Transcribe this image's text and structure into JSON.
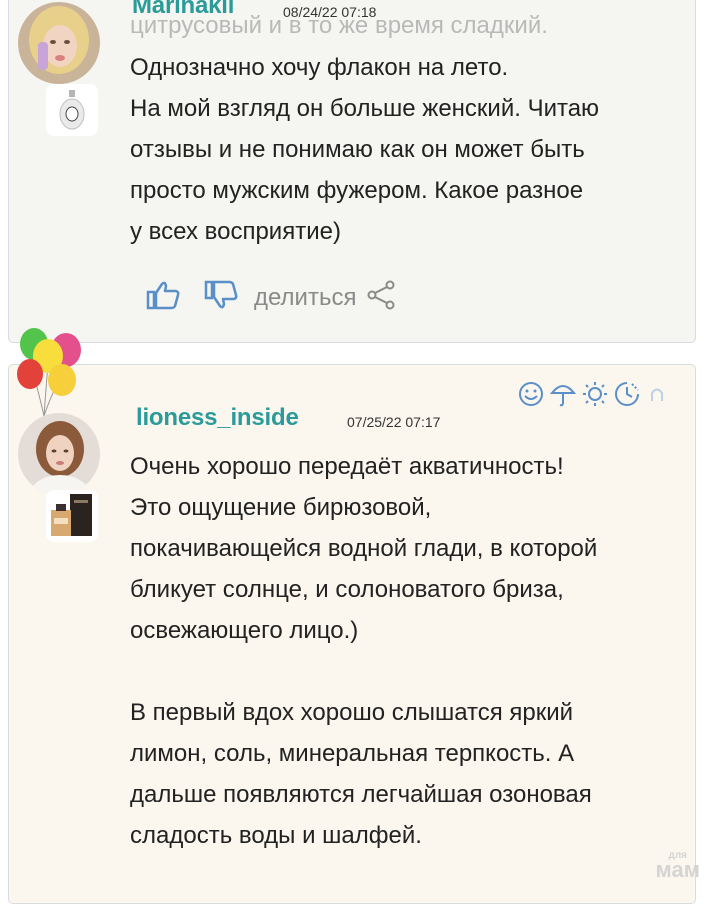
{
  "comments": [
    {
      "username": "Marinakli",
      "date": "08/24/22 07:18",
      "faded_line": "цитрусовый и в то же время сладкий.",
      "text": "Однозначно хочу флакон на лето.\nНа мой взгляд он больше женский. Читаю\nотзывы и не понимаю как он может быть\nпросто мужским фужером. Какое разное\nу всех восприятие)",
      "actions": {
        "share_label": "делиться"
      }
    },
    {
      "username": "lioness_inside",
      "date": "07/25/22 07:17",
      "text": "Очень хорошо передаёт акватичность!\nЭто ощущение бирюзовой,\nпокачивающейся водной глади, в которой\nбликует солнце, и солоноватого бриза,\nосвежающего лицо.)\n\nВ первый вдох хорошо слышатся яркий\nлимон, соль, минеральная терпкость. А\nдальше появляются легчайшая озоновая\nсладость воды и шалфей.",
      "mood_icons": [
        "smile-icon",
        "umbrella-icon",
        "sun-icon",
        "clock-icon",
        "night-icon"
      ]
    }
  ],
  "watermark": {
    "top": "для",
    "main": "мам"
  },
  "colors": {
    "username": "#2a9b98",
    "card1_bg": "#f5f5f1",
    "card2_bg": "#fbf7ee",
    "icon_blue": "#5a8fc8"
  }
}
